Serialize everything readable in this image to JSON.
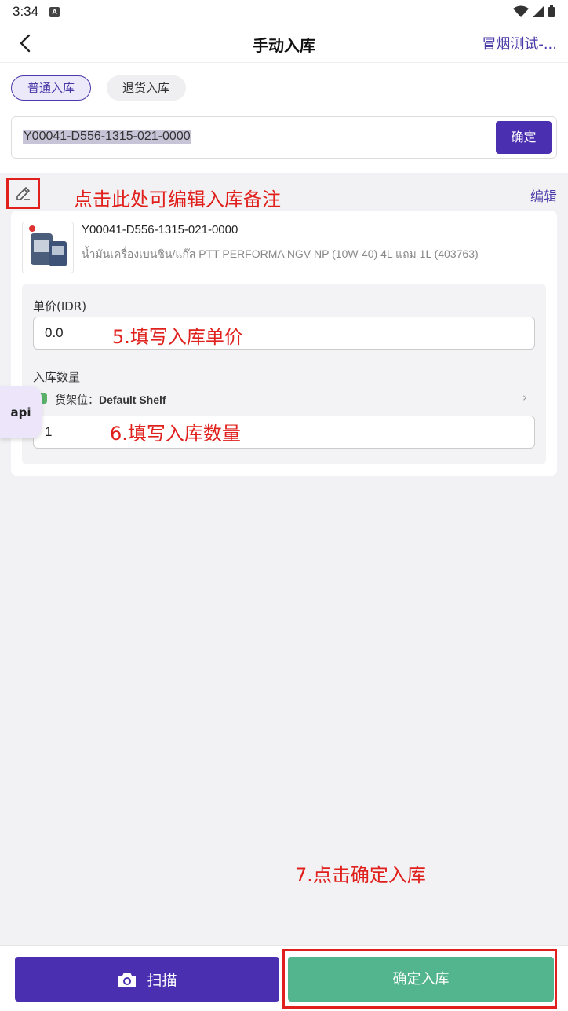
{
  "status_bar": {
    "time": "3:34",
    "notification_icon_letter": "A"
  },
  "header": {
    "title": "手动入库",
    "store_name": "冒烟测试-..."
  },
  "tabs": [
    {
      "label": "普通入库",
      "active": true
    },
    {
      "label": "退货入库",
      "active": false
    }
  ],
  "scan": {
    "value": "Y00041-D556-1315-021-0000",
    "confirm_label": "确定"
  },
  "note": {
    "annotation": "点击此处可编辑入库备注",
    "edit_label": "编辑"
  },
  "product": {
    "sku": "Y00041-D556-1315-021-0000",
    "name": "น้ำมันเครื่องเบนซิน/แก๊ส PTT PERFORMA NGV NP (10W-40) 4L แถม 1L (403763)",
    "price_label": "单价(IDR)",
    "price_value": "0.0",
    "price_annotation": "5.填写入库单价",
    "qty_label": "入库数量",
    "shelf_prefix": "货架位：",
    "shelf_value": "Default Shelf",
    "qty_value": "1",
    "qty_annotation": "6.填写入库数量"
  },
  "floating": {
    "api_label": "api"
  },
  "footer": {
    "annotation": "7.点击确定入库",
    "scan_label": "扫描",
    "confirm_stock_in_label": "确定入库"
  },
  "colors": {
    "primary": "#4a2fb0",
    "success": "#53b58d",
    "annotation": "#e0201c",
    "link": "#4a3aa8"
  },
  "icons": [
    "back-arrow-icon",
    "pencil-edit-icon",
    "camera-icon",
    "chevron-right-icon",
    "wifi-icon",
    "signal-icon",
    "battery-icon",
    "shelf-icon"
  ]
}
